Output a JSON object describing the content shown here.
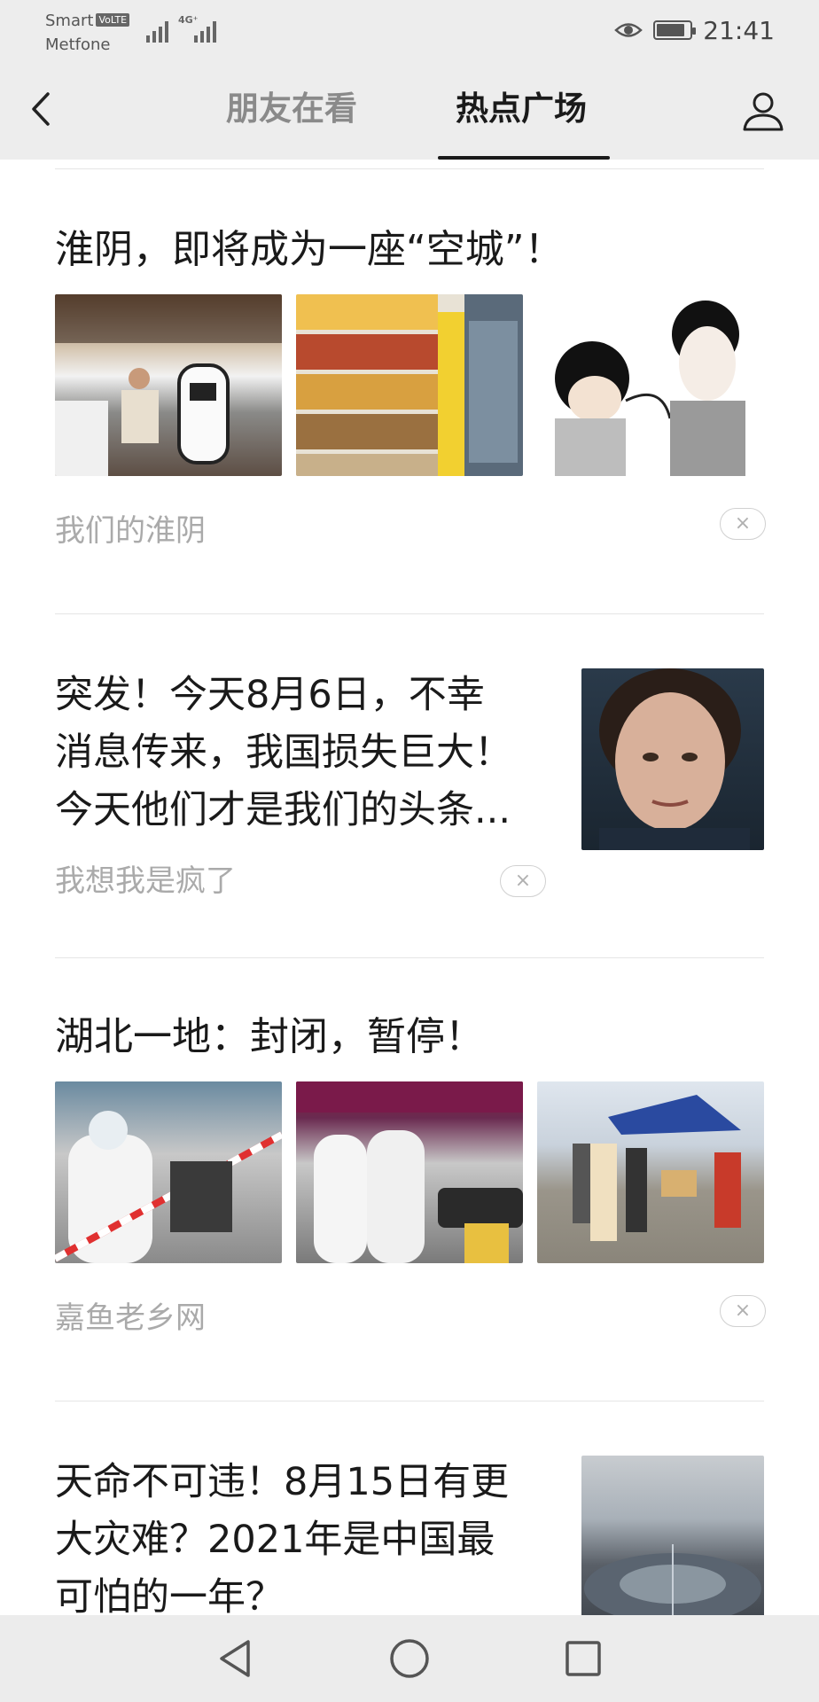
{
  "status_bar": {
    "carrier_line1": "Smart",
    "volte": "VoLTE",
    "carrier_line2": "Metfone",
    "network": "4G⁺",
    "time": "21:41",
    "battery_level": 0.85
  },
  "nav": {
    "tabs": [
      {
        "label": "朋友在看",
        "active": false
      },
      {
        "label": "热点广场",
        "active": true
      }
    ]
  },
  "articles": [
    {
      "title": "淮阴，即将成为一座“空城”！",
      "source": "我们的淮阴",
      "layout": "three-images",
      "dismiss": "×"
    },
    {
      "title_lines": [
        "突发！今天8月6日，不幸",
        "消息传来，我国损失巨大！",
        "今天他们才是我们的头条..."
      ],
      "source": "我想我是疯了",
      "layout": "single-image",
      "dismiss": "×"
    },
    {
      "title": "湖北一地：封闭，暂停！",
      "source": "嘉鱼老乡网",
      "layout": "three-images",
      "dismiss": "×"
    },
    {
      "title_lines": [
        "天命不可违！8月15日有更",
        "大灾难？2021年是中国最",
        "可怕的一年？"
      ],
      "layout": "single-image"
    }
  ],
  "colors": {
    "header_bg": "#ededed",
    "active_tab": "#1a1a1a",
    "inactive_tab": "#8a8a8a",
    "source_text": "#aaaaaa"
  }
}
